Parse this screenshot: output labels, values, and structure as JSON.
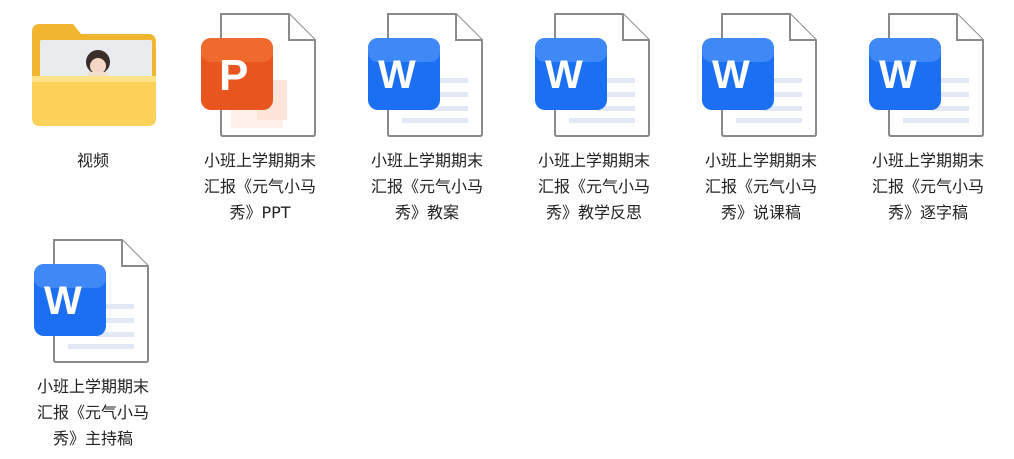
{
  "files": [
    {
      "type": "folder",
      "lines": [
        "视频"
      ]
    },
    {
      "type": "ppt",
      "badge": "P",
      "lines": [
        "小班上学期期末",
        "汇报《元气小马",
        "秀》PPT"
      ]
    },
    {
      "type": "word",
      "badge": "W",
      "lines": [
        "小班上学期期末",
        "汇报《元气小马",
        "秀》教案"
      ]
    },
    {
      "type": "word",
      "badge": "W",
      "lines": [
        "小班上学期期末",
        "汇报《元气小马",
        "秀》教学反思"
      ]
    },
    {
      "type": "word",
      "badge": "W",
      "lines": [
        "小班上学期期末",
        "汇报《元气小马",
        "秀》说课稿"
      ]
    },
    {
      "type": "word",
      "badge": "W",
      "lines": [
        "小班上学期期末",
        "汇报《元气小马",
        "秀》逐字稿"
      ]
    },
    {
      "type": "word",
      "badge": "W",
      "lines": [
        "小班上学期期末",
        "汇报《元气小马",
        "秀》主持稿"
      ]
    }
  ],
  "colors": {
    "folder": "#f7c94a",
    "folder_back": "#f3b733",
    "ppt": "#e8551f",
    "word": "#1b6ff2",
    "page_border": "#8a8a8a"
  }
}
